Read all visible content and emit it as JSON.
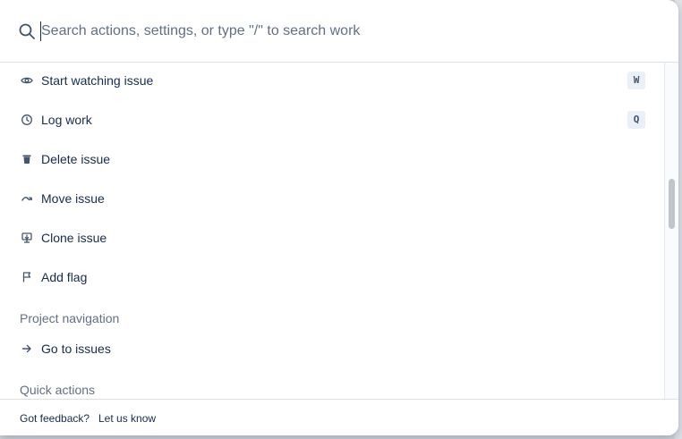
{
  "search": {
    "placeholder": "Search actions, settings, or type \"/\" to search work",
    "value": ""
  },
  "items": [
    {
      "label": "Start watching issue",
      "icon": "eye-icon",
      "shortcut": "W"
    },
    {
      "label": "Log work",
      "icon": "clock-icon",
      "shortcut": "Q"
    },
    {
      "label": "Delete issue",
      "icon": "trash-icon",
      "shortcut": ""
    },
    {
      "label": "Move issue",
      "icon": "move-icon",
      "shortcut": ""
    },
    {
      "label": "Clone issue",
      "icon": "clone-icon",
      "shortcut": ""
    },
    {
      "label": "Add flag",
      "icon": "flag-icon",
      "shortcut": ""
    }
  ],
  "sections": {
    "project_navigation": {
      "heading": "Project navigation",
      "items": [
        {
          "label": "Go to issues",
          "icon": "arrow-right-icon"
        }
      ]
    },
    "quick_actions": {
      "heading": "Quick actions"
    }
  },
  "footer": {
    "question": "Got feedback?",
    "link": "Let us know"
  },
  "colors": {
    "text": "#172b4d",
    "subtle": "#626f86",
    "icon": "#44546f",
    "kbd_bg": "#e9f0f7"
  }
}
